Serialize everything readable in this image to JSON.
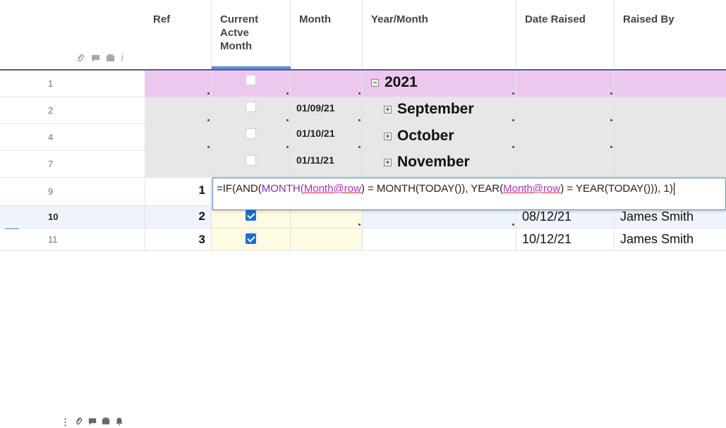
{
  "columns": {
    "ref": "Ref",
    "current_active_month_l1": "Current",
    "current_active_month_l2": "Actve",
    "current_active_month_l3": "Month",
    "month": "Month",
    "year_month": "Year/Month",
    "date_raised": "Date Raised",
    "raised_by": "Raised By"
  },
  "header_icons": [
    "attachment-icon",
    "comment-icon",
    "proof-icon",
    "info-icon"
  ],
  "rows": [
    {
      "num": "1",
      "tree_label": "2021",
      "tree_state": "−"
    },
    {
      "num": "2",
      "month": "01/09/21",
      "tree_label": "September",
      "tree_state": "+"
    },
    {
      "num": "4",
      "month": "01/10/21",
      "tree_label": "October",
      "tree_state": "+"
    },
    {
      "num": "7",
      "month": "01/11/21",
      "tree_label": "November",
      "tree_state": "+"
    },
    {
      "num": "9",
      "ref": "1"
    },
    {
      "num": "10",
      "ref": "2",
      "date": "08/12/21",
      "raised_by": "James Smith"
    },
    {
      "num": "11",
      "ref": "3",
      "date": "10/12/21",
      "raised_by": "James Smith"
    }
  ],
  "formula": {
    "t1": "=IF(AND(",
    "t2": "MONTH(",
    "ref1": "Month@row",
    "t3": ") = MONTH(TODAY(",
    "t4": ")), YEAR(",
    "ref2": "Month@row",
    "t5": ") = YEAR(TODAY(",
    "t6": "))), 1",
    "t7": ")"
  },
  "colors": {
    "header_line": "#5a5a9a",
    "row1_bg": "#ecc8ef",
    "group_bg": "#e7e7e7",
    "selected_row_bg": "#eef4fb",
    "active_col_bg": "#fffbe3",
    "accent": "#1a6fd8"
  }
}
